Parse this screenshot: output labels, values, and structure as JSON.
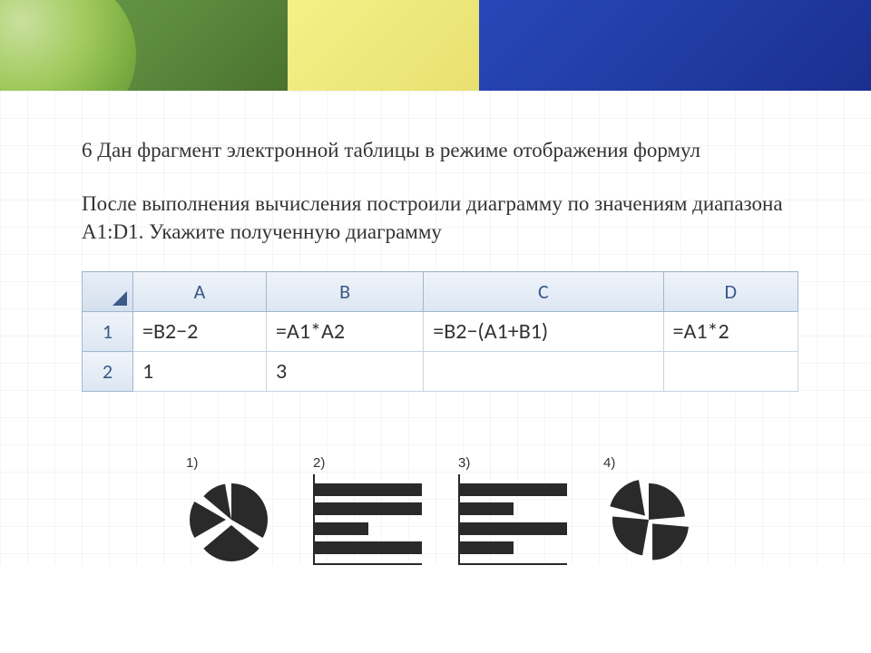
{
  "question": {
    "number": "6",
    "title": "Дан фрагмент электронной таблицы в режиме отображения формул",
    "subtitle": "После выполнения вычисления построили диаграмму по значениям диапазона A1:D1. Укажите полученную диаграмму"
  },
  "spreadsheet": {
    "columns": [
      "A",
      "B",
      "C",
      "D"
    ],
    "rows": [
      {
        "n": "1",
        "cells": [
          "=B2−2",
          "=A1*A2",
          "=B2−(A1+B1)",
          "=A1*2"
        ]
      },
      {
        "n": "2",
        "cells": [
          "1",
          "3",
          "",
          ""
        ]
      }
    ]
  },
  "options": {
    "labels": [
      "1)",
      "2)",
      "3)",
      "4)"
    ],
    "pie1_slices": [
      {
        "start": 0,
        "end": 120,
        "offset": 0
      },
      {
        "start": 130,
        "end": 230,
        "offset": 6
      },
      {
        "start": 240,
        "end": 300,
        "offset": 6
      },
      {
        "start": 310,
        "end": 350,
        "offset": 0
      }
    ],
    "bars2": [
      100,
      100,
      50,
      100
    ],
    "bars3": [
      100,
      50,
      100,
      50
    ],
    "pie4_slices": [
      {
        "start": 0,
        "end": 85,
        "offset": 0
      },
      {
        "start": 95,
        "end": 180,
        "offset": 6
      },
      {
        "start": 190,
        "end": 275,
        "offset": 0
      },
      {
        "start": 285,
        "end": 350,
        "offset": 6
      }
    ]
  },
  "colors": {
    "dark": "#2a2a2a",
    "header_bg": "#dce6f2",
    "border": "#a0b8d0"
  }
}
